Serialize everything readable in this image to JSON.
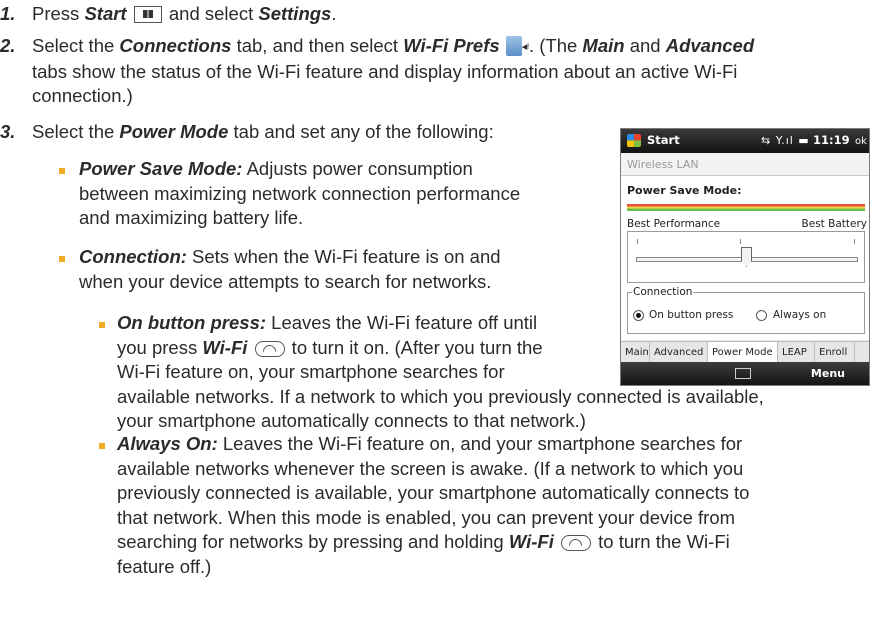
{
  "step1": {
    "num": "1.",
    "press": "Press ",
    "start": "Start",
    "and_select": " and select ",
    "settings": "Settings",
    "end": "."
  },
  "step2": {
    "num": "2.",
    "line1_a": "Select the ",
    "connections": "Connections",
    "line1_b": " tab, and then select ",
    "wifiprefs": "Wi-Fi Prefs",
    "line1_c": ". (The ",
    "main": "Main",
    "line1_d": " and ",
    "advanced": "Advanced",
    "line2": "tabs show the status of the Wi-Fi feature and display information about an active Wi-Fi",
    "line3": "connection.)"
  },
  "step3": {
    "num": "3.",
    "a": "Select the ",
    "power_mode": "Power Mode",
    "b": " tab and set any of the following:"
  },
  "bullets": {
    "psm_label": "Power Save Mode:",
    "psm_l1": " Adjusts power consumption",
    "psm_l2": "between maximizing network connection performance",
    "psm_l3": "and maximizing battery life.",
    "conn_label": "Connection:",
    "conn_l1": " Sets when the Wi-Fi feature is on and",
    "conn_l2": "when your device attempts to search for networks."
  },
  "sub1": {
    "label": "On button press:",
    "l1": " Leaves the Wi-Fi feature off until",
    "l2_a": "you press ",
    "wifi": "Wi-Fi",
    "l2_b": " to turn it on. (After you turn the",
    "l3": "Wi-Fi feature on, your smartphone searches for",
    "l4": "available networks. If a network to which you previously connected is available,",
    "l5": "your smartphone automatically connects to that network.)"
  },
  "sub2": {
    "label": "Always On:",
    "l1": " Leaves the Wi-Fi feature on, and your smartphone searches for",
    "l2": "available networks whenever the screen is awake. (If a network to which you",
    "l3": "previously connected is available, your smartphone automatically connects to",
    "l4": "that network. When this mode is enabled, you can prevent your device from",
    "l5_a": "searching for networks by pressing and holding ",
    "wifi": "Wi-Fi",
    "l5_b": " to turn the Wi-Fi",
    "l6": "feature off.)"
  },
  "phone": {
    "start": "Start",
    "time": "11:19",
    "ok": "ok",
    "title": "Wireless LAN",
    "psm": "Power Save Mode:",
    "best_perf": "Best Performance",
    "best_batt": "Best Battery",
    "power_level": 0.5,
    "connection": "Connection",
    "opt1": "On button press",
    "opt2": "Always on",
    "selected_option": "On button press",
    "tabs": [
      "Main",
      "Advanced",
      "Power Mode",
      "LEAP",
      "Enroll"
    ],
    "active_tab": "Power Mode",
    "menu": "Menu"
  },
  "colors": {
    "bullet": "#f0ab21",
    "text": "#2b2b2b"
  }
}
